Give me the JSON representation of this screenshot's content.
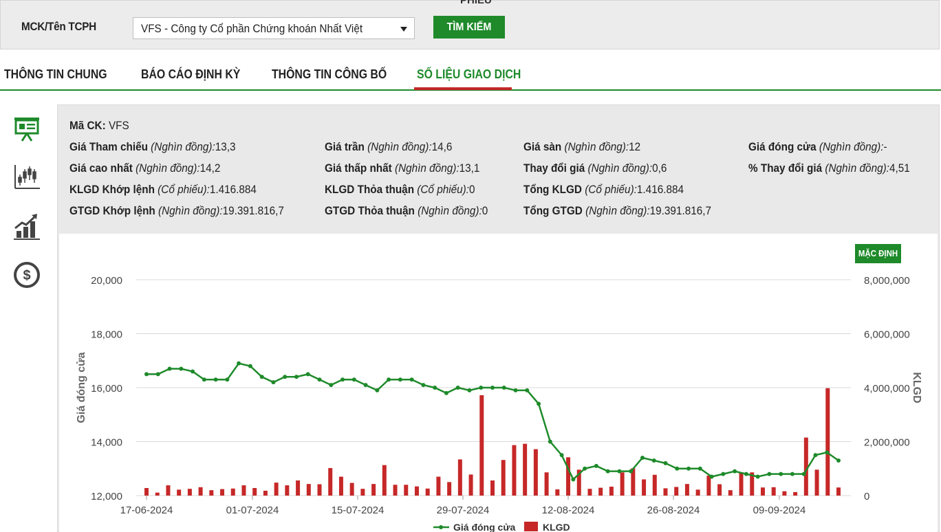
{
  "search": {
    "top_cut_text": "PHIẾU",
    "label": "MCK/Tên TCPH",
    "selected_value": "VFS - Công ty Cổ phần Chứng khoán Nhất Việt",
    "button_label": "TÌM KIẾM"
  },
  "tabs": [
    {
      "label": "THÔNG TIN CHUNG"
    },
    {
      "label": "BÁO CÁO ĐỊNH KỲ"
    },
    {
      "label": "THÔNG TIN CÔNG BỐ"
    },
    {
      "label": "SỐ LIỆU GIAO DỊCH",
      "active": true
    }
  ],
  "sidebar": {
    "icons": [
      "presentation-board-icon",
      "candlestick-chart-icon",
      "growth-bar-chart-icon",
      "dollar-coin-icon"
    ]
  },
  "info": {
    "code_label": "Mã CK:",
    "code_value": "VFS",
    "unit_dong": "(Nghìn đồng):",
    "unit_cp": "(Cổ phiếu):",
    "rows": [
      [
        {
          "label": "Giá Tham chiếu",
          "unit": "(Nghìn đồng):",
          "value": "13,3"
        },
        {
          "label": "Giá trần",
          "unit": "(Nghìn đồng):",
          "value": "14,6"
        },
        {
          "label": "Giá sàn",
          "unit": "(Nghìn đồng):",
          "value": "12"
        },
        {
          "label": "Giá đóng cửa",
          "unit": "(Nghìn đồng):",
          "value": "-"
        }
      ],
      [
        {
          "label": "Giá cao nhất",
          "unit": "(Nghìn đồng):",
          "value": "14,2"
        },
        {
          "label": "Giá thấp nhất",
          "unit": "(Nghìn đồng):",
          "value": "13,1"
        },
        {
          "label": "Thay đổi giá",
          "unit": "(Nghìn đồng):",
          "value": "0,6"
        },
        {
          "label": "% Thay đổi giá",
          "unit": "(Nghìn đồng):",
          "value": "4,51"
        }
      ],
      [
        {
          "label": "KLGD Khớp lệnh",
          "unit": "(Cổ phiếu):",
          "value": "1.416.884"
        },
        {
          "label": "KLGD Thỏa thuận",
          "unit": "(Cổ phiếu):",
          "value": "0"
        },
        {
          "label": "Tổng KLGD",
          "unit": "(Cổ phiếu):",
          "value": "1.416.884"
        }
      ],
      [
        {
          "label": "GTGD Khớp lệnh",
          "unit": "(Nghìn đồng):",
          "value": "19.391.816,7"
        },
        {
          "label": "GTGD Thỏa thuận",
          "unit": "(Nghìn đồng):",
          "value": "0"
        },
        {
          "label": "Tổng GTGD",
          "unit": "(Nghìn đồng):",
          "value": "19.391.816,7"
        }
      ]
    ]
  },
  "chart_controls": {
    "default_label": "MẶC ĐỊNH"
  },
  "colors": {
    "brand_green": "#1e8a2a",
    "bar_red": "#c62828",
    "tab_underline": "#c62828"
  },
  "chart_data": {
    "type": "line+bar",
    "y_left_label": "Giá đóng cửa",
    "y_right_label": "KLGD",
    "y_left_ticks": [
      "20,000",
      "18,000",
      "16,000",
      "14,000",
      "12,000"
    ],
    "y_right_ticks": [
      "8,000,000",
      "6,000,000",
      "4,000,000",
      "2,000,000",
      "0"
    ],
    "ylim_left": [
      12000,
      20000
    ],
    "ylim_right": [
      0,
      8000000
    ],
    "x_ticks": [
      "17-06-2024",
      "01-07-2024",
      "15-07-2024",
      "29-07-2024",
      "12-08-2024",
      "26-08-2024",
      "09-09-2024"
    ],
    "legend": [
      "Giá đóng cửa",
      "KLGD"
    ],
    "legend_position": "bottom",
    "series": [
      {
        "name": "Giá đóng cửa",
        "type": "line",
        "color": "#1e8a2a",
        "values": [
          16500,
          16500,
          16700,
          16700,
          16600,
          16300,
          16300,
          16300,
          16900,
          16800,
          16400,
          16200,
          16400,
          16400,
          16500,
          16300,
          16100,
          16300,
          16300,
          16100,
          15900,
          16300,
          16300,
          16300,
          16100,
          16000,
          15800,
          16000,
          15900,
          16000,
          16000,
          16000,
          15900,
          15900,
          15400,
          14000,
          13500,
          12600,
          13000,
          13100,
          12900,
          12900,
          12900,
          13400,
          13300,
          13200,
          13000,
          13000,
          13000,
          12700,
          12800,
          12900,
          12800,
          12700,
          12800,
          12800,
          12800,
          12800,
          13500,
          13600,
          13300
        ]
      },
      {
        "name": "KLGD",
        "type": "bar",
        "color": "#c62828",
        "values": [
          280000,
          110000,
          380000,
          220000,
          250000,
          310000,
          200000,
          240000,
          260000,
          380000,
          280000,
          180000,
          480000,
          380000,
          560000,
          430000,
          420000,
          1020000,
          700000,
          470000,
          250000,
          430000,
          1130000,
          400000,
          400000,
          340000,
          260000,
          700000,
          500000,
          1340000,
          780000,
          3720000,
          560000,
          1320000,
          1870000,
          1920000,
          1720000,
          860000,
          230000,
          1420000,
          960000,
          250000,
          290000,
          330000,
          860000,
          1010000,
          600000,
          770000,
          270000,
          320000,
          430000,
          220000,
          740000,
          420000,
          200000,
          850000,
          860000,
          300000,
          310000,
          160000,
          130000,
          2150000,
          960000,
          3980000,
          300000
        ]
      }
    ]
  }
}
